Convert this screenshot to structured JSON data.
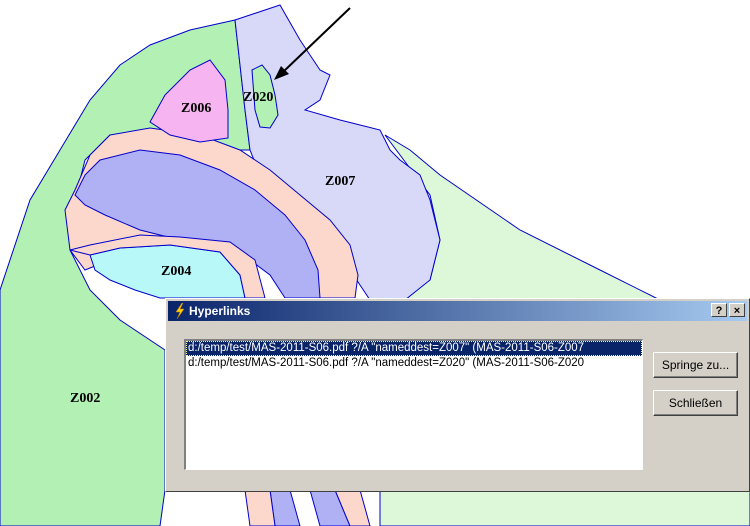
{
  "map": {
    "zones": [
      "Z002",
      "Z004",
      "Z006",
      "Z007",
      "Z020"
    ],
    "colors": {
      "green": "#b3f0b3",
      "light_green": "#ddf8d8",
      "lavender": "#d8d8f8",
      "blue": "#b0b0f4",
      "salmon": "#fcd8cc",
      "pink": "#f6b4f0",
      "cyan": "#b8f8f8",
      "outline": "#0000cc"
    }
  },
  "dialog": {
    "title": "Hyperlinks",
    "help_label": "?",
    "close_label": "×",
    "links": [
      "d:/temp/test/MAS-2011-S06.pdf ?/A \"nameddest=Z007\"  (MAS-2011-S06-Z007",
      "d:/temp/test/MAS-2011-S06.pdf ?/A \"nameddest=Z020\"  (MAS-2011-S06-Z020"
    ],
    "jump_label": "Springe zu...",
    "close_button_label": "Schließen"
  }
}
